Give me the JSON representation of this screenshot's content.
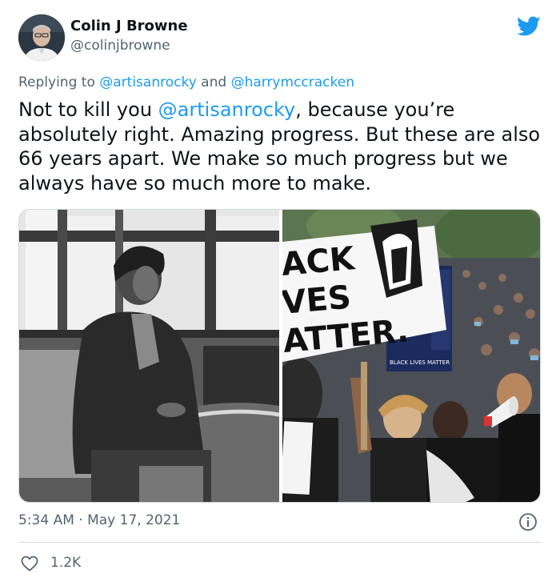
{
  "tweet": {
    "author_name": "Colin J Browne",
    "author_handle": "@colinjbrowne",
    "replying_prefix": "Replying to",
    "replying_users": [
      "@artisanrocky",
      "@harrymccracken"
    ],
    "replying_joiner": "and",
    "text_before_mention": "Not to kill you ",
    "text_mention": "@artisanrocky",
    "text_after_mention": ", because you’re absolutely right. Amazing progress. But these are also 66 years apart. We make so much progress but we always have so much more to make.",
    "timestamp": "5:34 AM · May 17, 2021",
    "like_count": "1.2K"
  },
  "media": {
    "right_image": {
      "sign_lines": [
        "ACK",
        "VES",
        "ATTER."
      ],
      "small_sign_text": "BLACK LIVES MATTER"
    }
  },
  "icons": {
    "brand": "twitter-bird-icon",
    "info": "info-icon",
    "like": "heart-icon"
  },
  "colors": {
    "link": "#1d9bf0",
    "secondary_text": "#536471",
    "primary_text": "#0f1419",
    "divider": "#cfd9de"
  }
}
